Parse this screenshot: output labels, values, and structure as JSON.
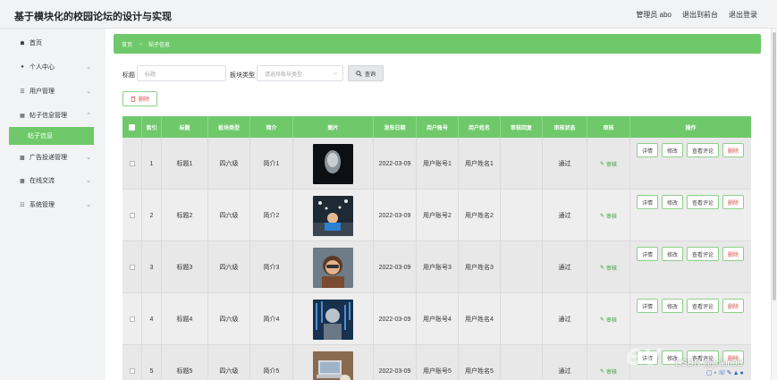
{
  "app": {
    "title": "基于模块化的校园论坛的设计与实现",
    "admin_label": "管理员 abo",
    "back_front": "退出到前台",
    "logout": "退出登录"
  },
  "sidebar": {
    "items": [
      {
        "label": "首页",
        "icon": "home-icon",
        "has_children": false
      },
      {
        "label": "个人中心",
        "icon": "user-icon",
        "has_children": true
      },
      {
        "label": "用户管理",
        "icon": "list-icon",
        "has_children": true
      },
      {
        "label": "帖子信息管理",
        "icon": "grid-icon",
        "has_children": true
      },
      {
        "label": "广告投递管理",
        "icon": "apps-icon",
        "has_children": true
      },
      {
        "label": "在线交流",
        "icon": "apps-icon",
        "has_children": true
      },
      {
        "label": "系统管理",
        "icon": "menu-icon",
        "has_children": true
      }
    ],
    "active_sub": "帖子信息"
  },
  "breadcrumb": {
    "home": "首页",
    "sep": "→",
    "current": "帖子信息"
  },
  "filters": {
    "title_label": "标题",
    "title_placeholder": "标题",
    "type_label": "板块类型",
    "type_placeholder": "请选择板块类型",
    "query_label": "查询"
  },
  "toolbar": {
    "delete_label": "删除"
  },
  "table": {
    "columns": [
      "索引",
      "标题",
      "板块类型",
      "简介",
      "图片",
      "发布日期",
      "用户账号",
      "用户姓名",
      "审核回复",
      "审核状态",
      "审核",
      "操作"
    ],
    "rows": [
      {
        "index": "1",
        "title": "标题1",
        "type": "四六级",
        "intro": "简介1",
        "date": "2022-03-09",
        "account": "用户账号1",
        "name": "用户姓名1",
        "reply": "",
        "status": "通过",
        "audit": "审核"
      },
      {
        "index": "2",
        "title": "标题2",
        "type": "四六级",
        "intro": "简介2",
        "date": "2022-03-09",
        "account": "用户账号2",
        "name": "用户姓名2",
        "reply": "",
        "status": "通过",
        "audit": "审核"
      },
      {
        "index": "3",
        "title": "标题3",
        "type": "四六级",
        "intro": "简介3",
        "date": "2022-03-09",
        "account": "用户账号3",
        "name": "用户姓名3",
        "reply": "",
        "status": "通过",
        "audit": "审核"
      },
      {
        "index": "4",
        "title": "标题4",
        "type": "四六级",
        "intro": "简介4",
        "date": "2022-03-09",
        "account": "用户账号4",
        "name": "用户姓名4",
        "reply": "",
        "status": "通过",
        "audit": "审核"
      },
      {
        "index": "5",
        "title": "标题5",
        "type": "四六级",
        "intro": "简介5",
        "date": "2022-03-09",
        "account": "用户账号5",
        "name": "用户姓名5",
        "reply": "",
        "status": "通过",
        "audit": "审核"
      }
    ],
    "ops": {
      "detail": "详情",
      "edit": "修改",
      "view_comments": "查看评论",
      "delete": "删除"
    }
  },
  "overlay": {
    "watermark": "ev",
    "csdn": "CSDN @jinkin05"
  },
  "colors": {
    "accent": "#6fc96a",
    "danger": "#d9534f"
  }
}
